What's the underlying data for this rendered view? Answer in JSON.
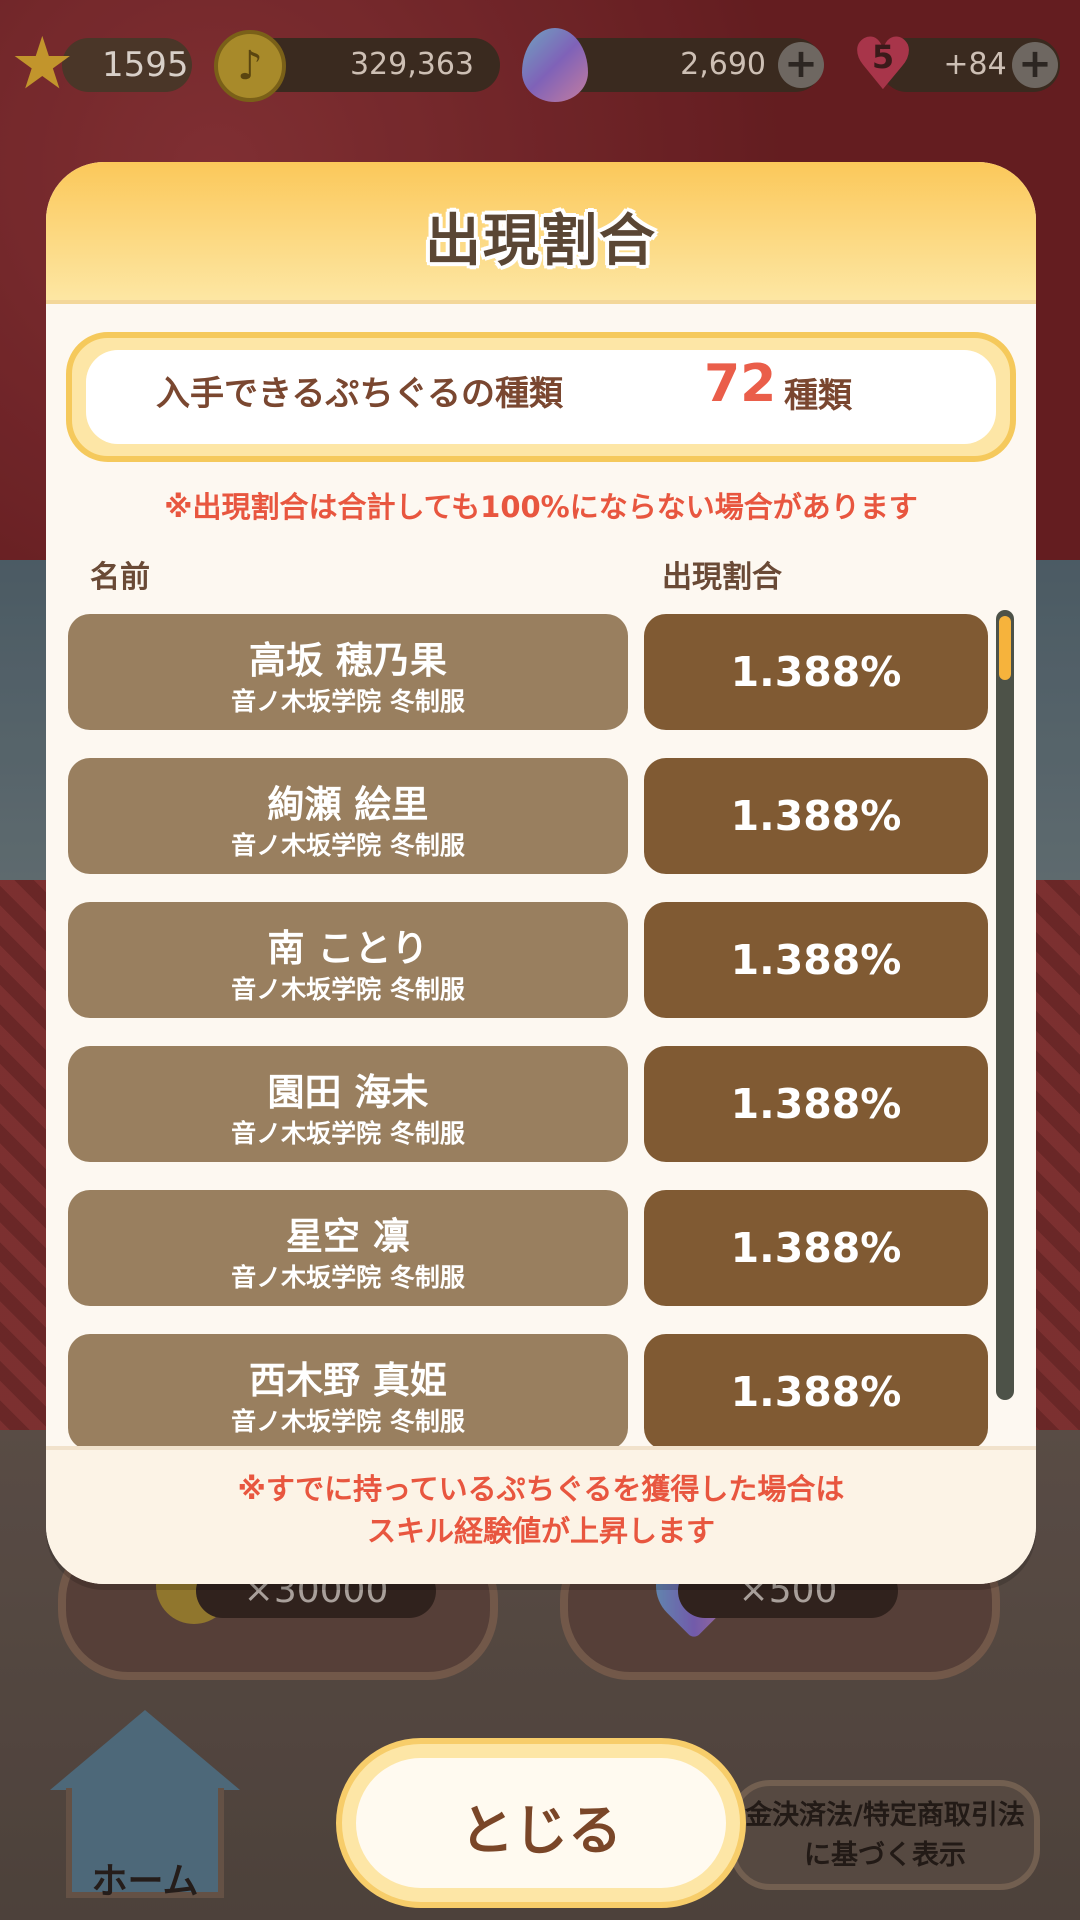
{
  "status_bar": {
    "level": "1595",
    "coins": "329,363",
    "gems": "2,690",
    "hearts_count": "5",
    "hearts_bonus": "+84",
    "icons": [
      "star-icon",
      "coin-icon",
      "gem-icon",
      "heart-icon",
      "plus-icon"
    ]
  },
  "modal": {
    "title": "出現割合",
    "count_label": "入手できるぷちぐるの種類",
    "count_value": "72",
    "count_unit": "種類",
    "note_top": "※出現割合は合計しても100%にならない場合があります",
    "col_name": "名前",
    "col_rate": "出現割合",
    "rows": [
      {
        "name": "高坂 穂乃果",
        "sub": "音ノ木坂学院 冬制服",
        "rate": "1.388%"
      },
      {
        "name": "絢瀬 絵里",
        "sub": "音ノ木坂学院 冬制服",
        "rate": "1.388%"
      },
      {
        "name": "南 ことり",
        "sub": "音ノ木坂学院 冬制服",
        "rate": "1.388%"
      },
      {
        "name": "園田 海未",
        "sub": "音ノ木坂学院 冬制服",
        "rate": "1.388%"
      },
      {
        "name": "星空 凛",
        "sub": "音ノ木坂学院 冬制服",
        "rate": "1.388%"
      },
      {
        "name": "西木野 真姫",
        "sub": "音ノ木坂学院 冬制服",
        "rate": "1.388%"
      }
    ],
    "footer_line1": "※すでに持っているぷちぐるを獲得した場合は",
    "footer_line2": "スキル経験値が上昇します"
  },
  "background": {
    "reward_left": "×30000",
    "reward_right": "×500",
    "home_label": "ホーム",
    "legal_line1": "金決済法/特定商取引法",
    "legal_line2": "に基づく表示"
  },
  "close_button": "とじる",
  "colors": {
    "header_gold": "#fbc85a",
    "name_cell": "#997f5f",
    "rate_cell": "#805a33",
    "note_red": "#e8563f",
    "count_red": "#ea5e4a"
  }
}
